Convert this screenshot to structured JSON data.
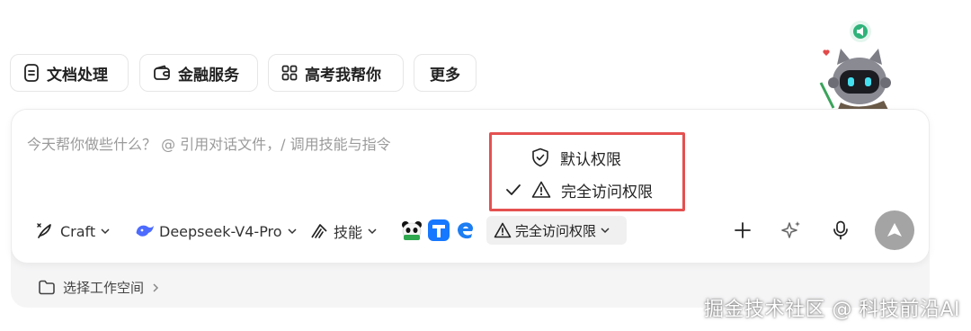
{
  "quick_actions": [
    {
      "label": "文档处理",
      "icon": "document-icon"
    },
    {
      "label": "金融服务",
      "icon": "wallet-icon"
    },
    {
      "label": "高考我帮你",
      "icon": "grid-icon"
    },
    {
      "label": "更多",
      "icon": ""
    }
  ],
  "composer": {
    "placeholder": "今天帮你做些什么？ @ 引用对话文件，/ 调用技能与指令"
  },
  "toolbar": {
    "mode_label": "Craft",
    "model_label": "Deepseek-V4-Pro",
    "skills_label": "技能",
    "permission_label": "完全访问权限"
  },
  "permission_menu": {
    "items": [
      {
        "label": "默认权限",
        "icon": "shield-check-icon",
        "selected": false
      },
      {
        "label": "完全访问权限",
        "icon": "warning-icon",
        "selected": true
      }
    ],
    "highlight_color": "#e55050"
  },
  "workspace": {
    "label": "选择工作空间"
  },
  "watermark": "掘金技术社区 @ 科技前沿AI",
  "colors": {
    "send_button": "#a4a4a4",
    "menu_border": "#e55050"
  }
}
